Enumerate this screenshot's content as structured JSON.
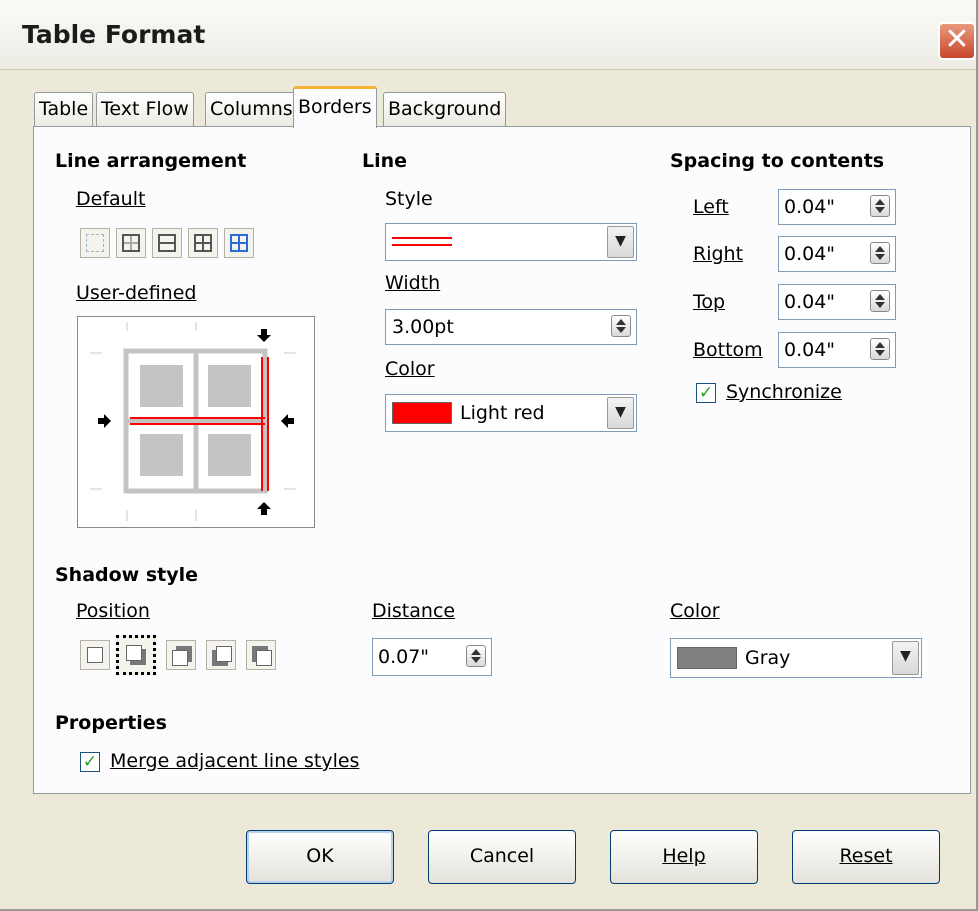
{
  "window": {
    "title": "Table Format",
    "close_glyph": "✕"
  },
  "tabs": [
    {
      "label": "Table",
      "active": false
    },
    {
      "label": "Text Flow",
      "active": false
    },
    {
      "label": "Columns",
      "active": false
    },
    {
      "label": "Borders",
      "active": true
    },
    {
      "label": "Background",
      "active": false
    }
  ],
  "line_arrangement": {
    "heading": "Line arrangement",
    "default_label": "Default",
    "default_presets": [
      "no-border-icon",
      "outer-border-icon",
      "outer-horizontal-icon",
      "outer-all-inner-icon",
      "outer-no-inner-icon"
    ],
    "user_defined_label": "User-defined"
  },
  "line": {
    "heading": "Line",
    "style_label": "Style",
    "style_value": "double red line",
    "width_label": "Width",
    "width_value": "3.00pt",
    "color_label": "Color",
    "color_value": "Light red",
    "color_swatch": "#ff0000"
  },
  "spacing": {
    "heading": "Spacing to contents",
    "left_label": "Left",
    "left_value": "0.04\"",
    "right_label": "Right",
    "right_value": "0.04\"",
    "top_label": "Top",
    "top_value": "0.04\"",
    "bottom_label": "Bottom",
    "bottom_value": "0.04\"",
    "synchronize_label": "Synchronize",
    "synchronize_checked": true
  },
  "shadow": {
    "heading": "Shadow style",
    "position_label": "Position",
    "position_options": [
      "no-shadow-icon",
      "shadow-bottom-right-icon",
      "shadow-top-right-icon",
      "shadow-bottom-left-icon",
      "shadow-top-left-icon"
    ],
    "distance_label": "Distance",
    "distance_value": "0.07\"",
    "color_label": "Color",
    "color_value": "Gray",
    "color_swatch": "#808080"
  },
  "properties": {
    "heading": "Properties",
    "merge_label": "Merge adjacent line styles",
    "merge_checked": true
  },
  "buttons": {
    "ok": "OK",
    "cancel": "Cancel",
    "help": "Help",
    "reset": "Reset"
  }
}
